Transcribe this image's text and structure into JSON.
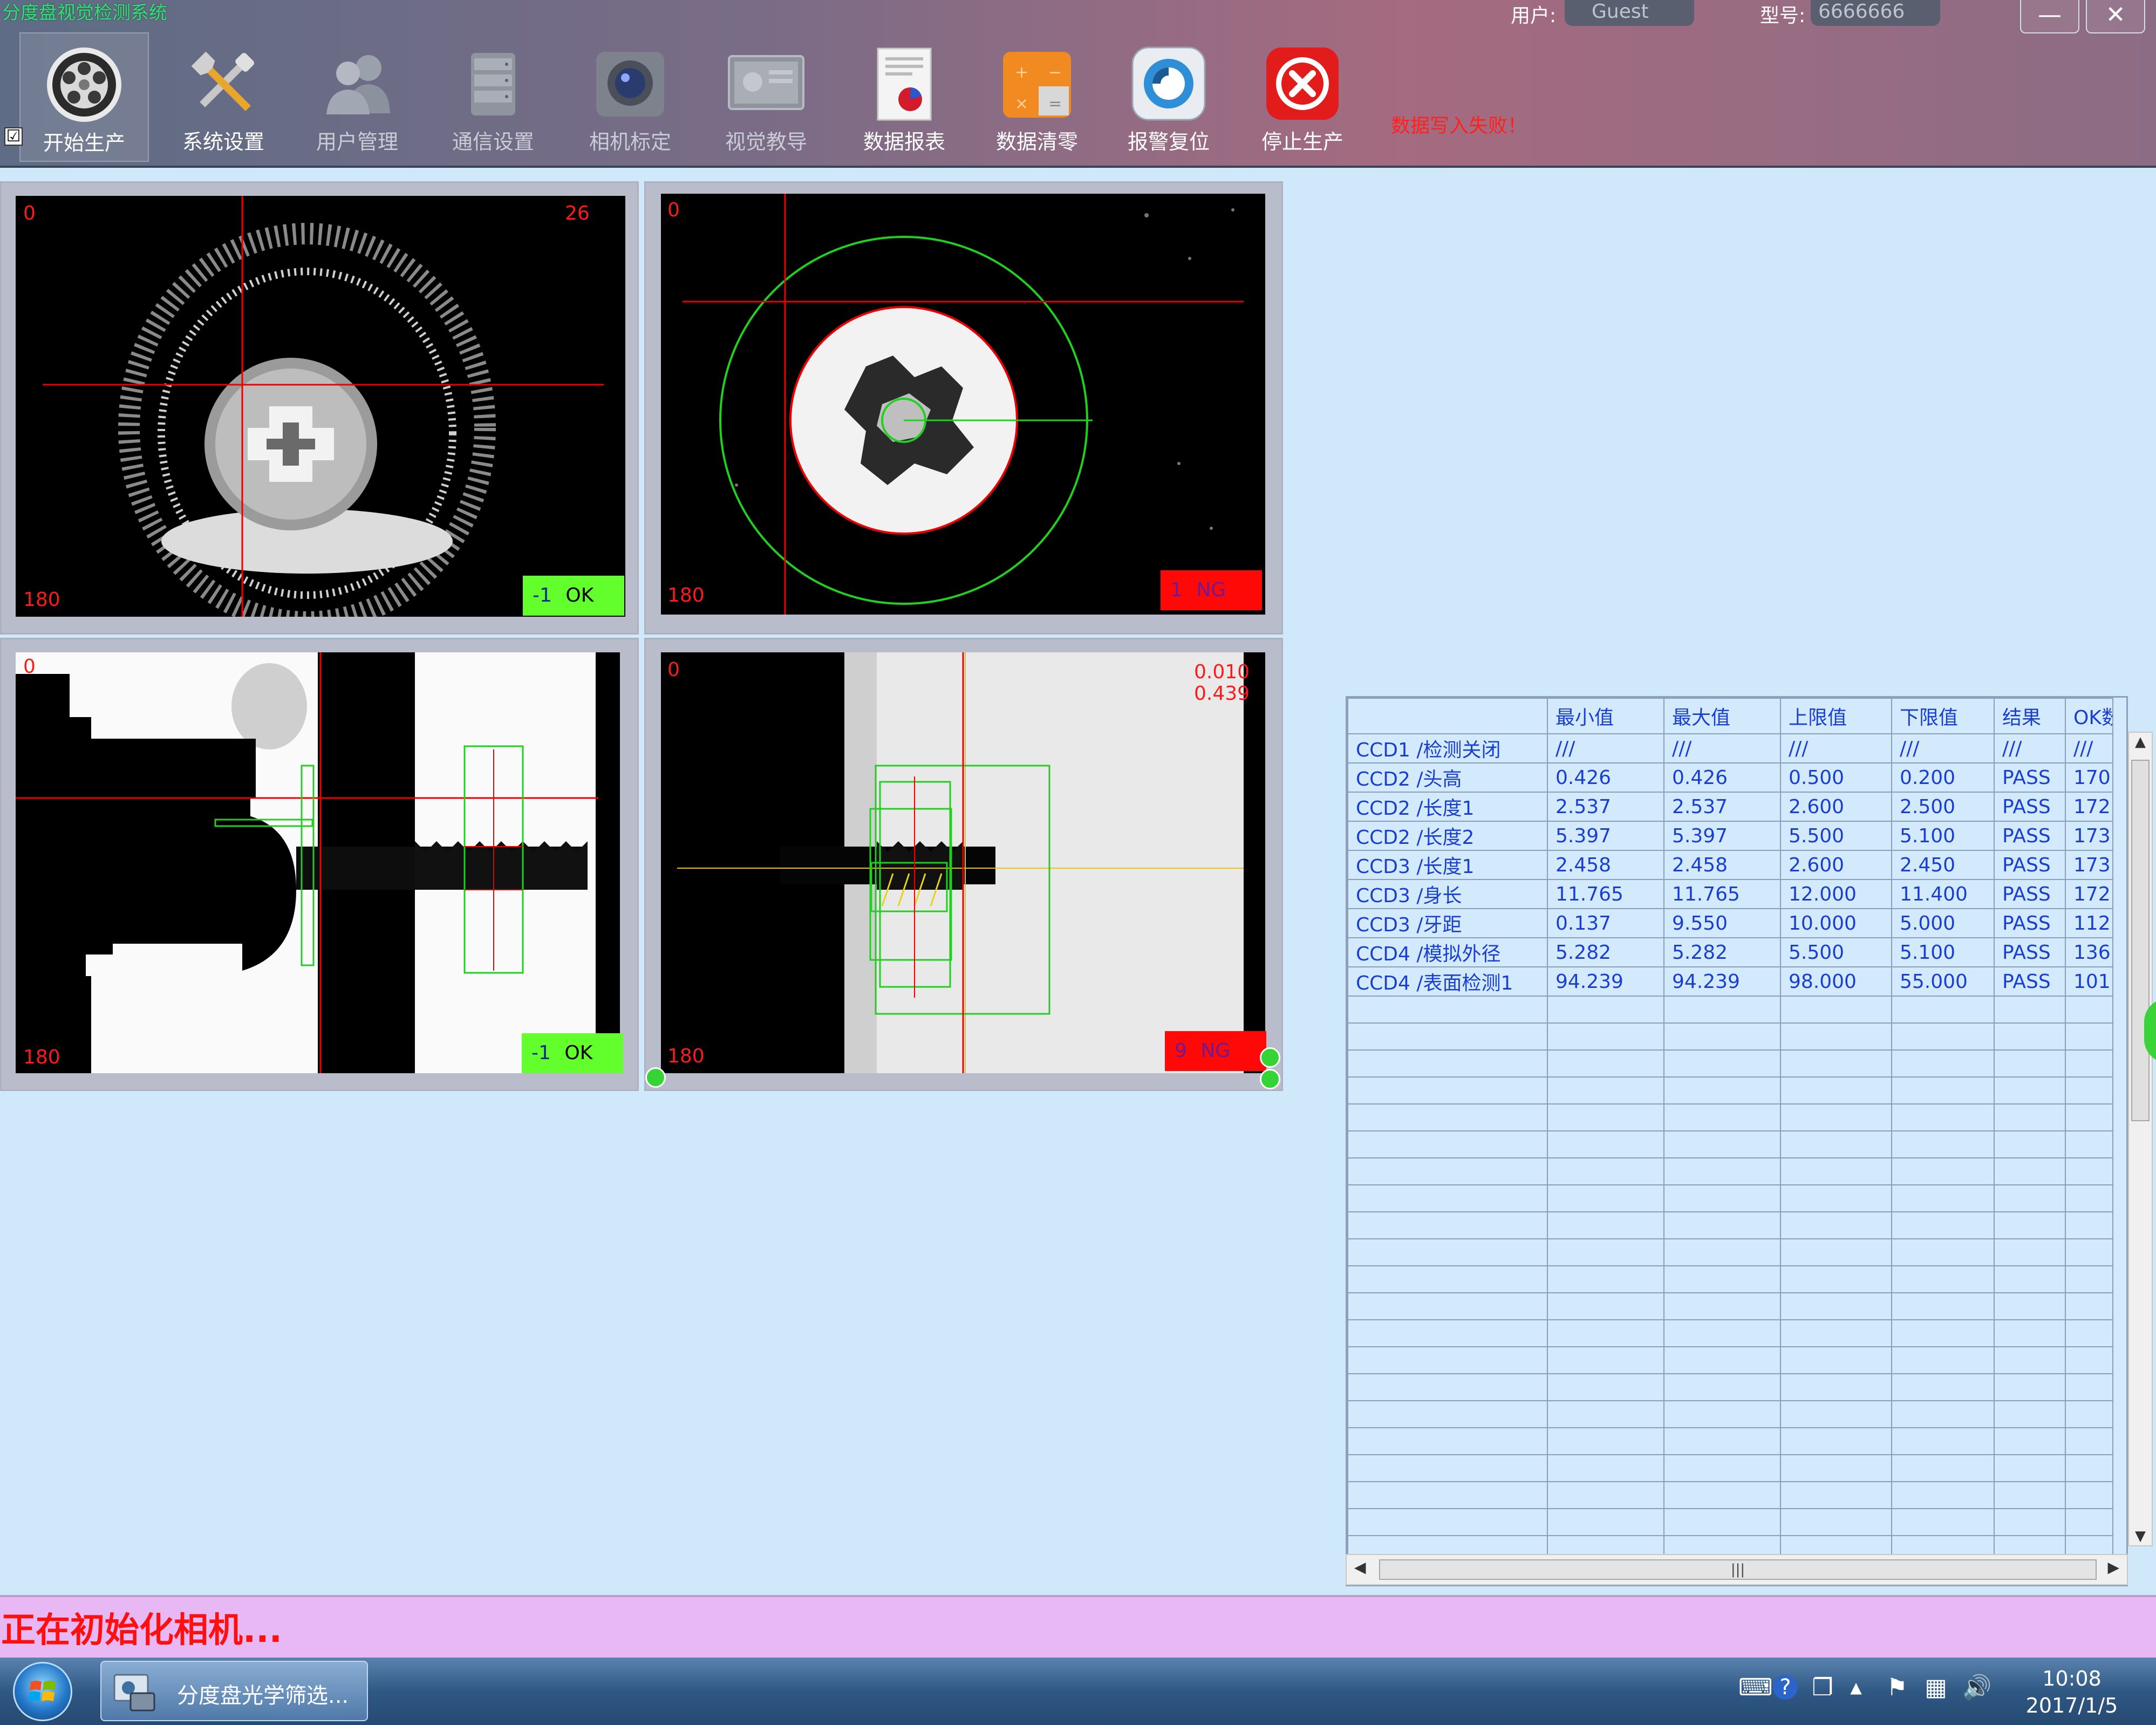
{
  "window": {
    "title": "分度盘视觉检测系统",
    "user_label": "用户:",
    "user_value": "Guest",
    "model_label": "型号:",
    "model_value": "6666666",
    "minimize_glyph": "—",
    "close_glyph": "✕"
  },
  "toolbar": {
    "tools": [
      {
        "label": "开始生产",
        "icon": "wheel-icon"
      },
      {
        "label": "系统设置",
        "icon": "tools-icon"
      },
      {
        "label": "用户管理",
        "icon": "users-icon"
      },
      {
        "label": "通信设置",
        "icon": "server-icon"
      },
      {
        "label": "相机标定",
        "icon": "camera-icon"
      },
      {
        "label": "视觉教导",
        "icon": "screen-icon"
      },
      {
        "label": "数据报表",
        "icon": "report-icon"
      },
      {
        "label": "数据清零",
        "icon": "calculator-icon"
      },
      {
        "label": "报警复位",
        "icon": "reset-icon"
      },
      {
        "label": "停止生产",
        "icon": "stop-icon"
      }
    ],
    "start_checkbox": "☑",
    "alarm_message": "数据写入失败！"
  },
  "cameras": [
    {
      "id": "ccd1",
      "tl": "0",
      "tr": "26",
      "bl": "180",
      "count": "-1",
      "result": "OK"
    },
    {
      "id": "ccd2",
      "tl": "0",
      "tr": "",
      "bl": "180",
      "count": "1",
      "result": "NG"
    },
    {
      "id": "ccd3",
      "tl": "0",
      "tr": "",
      "bl": "180",
      "count": "-1",
      "result": "OK"
    },
    {
      "id": "ccd4",
      "tl": "0",
      "tr1": "0.010",
      "tr2": "0.439",
      "bl": "180",
      "count": "9",
      "result": "NG"
    }
  ],
  "colors": {
    "ok": "#62ff2c",
    "ng": "#ff0808",
    "grid_text": "#1a3fd0",
    "status_text": "#ff1010"
  },
  "grid": {
    "headers": [
      "",
      "最小值",
      "最大值",
      "上限值",
      "下限值",
      "结果",
      "OK数"
    ],
    "rows": [
      [
        "CCD1 /检测关闭",
        "///",
        "///",
        "///",
        "///",
        "///",
        "///"
      ],
      [
        "CCD2 /头高",
        "0.426",
        "0.426",
        "0.500",
        "0.200",
        "PASS",
        "170"
      ],
      [
        "CCD2 /长度1",
        "2.537",
        "2.537",
        "2.600",
        "2.500",
        "PASS",
        "172"
      ],
      [
        "CCD2 /长度2",
        "5.397",
        "5.397",
        "5.500",
        "5.100",
        "PASS",
        "173"
      ],
      [
        "CCD3 /长度1",
        "2.458",
        "2.458",
        "2.600",
        "2.450",
        "PASS",
        "173"
      ],
      [
        "CCD3 /身长",
        "11.765",
        "11.765",
        "12.000",
        "11.400",
        "PASS",
        "172"
      ],
      [
        "CCD3 /牙距",
        "0.137",
        "9.550",
        "10.000",
        "5.000",
        "PASS",
        "112"
      ],
      [
        "CCD4 /模拟外径",
        "5.282",
        "5.282",
        "5.500",
        "5.100",
        "PASS",
        "136"
      ],
      [
        "CCD4 /表面检测1",
        "94.239",
        "94.239",
        "98.000",
        "55.000",
        "PASS",
        "101"
      ]
    ],
    "hscroll_grip": "|||"
  },
  "status": {
    "message": "正在初始化相机..."
  },
  "taskbar": {
    "app_label": "分度盘光学筛选...",
    "time": "10:08",
    "date": "2017/1/5",
    "tray_help": "?",
    "tray_up": "▲"
  }
}
